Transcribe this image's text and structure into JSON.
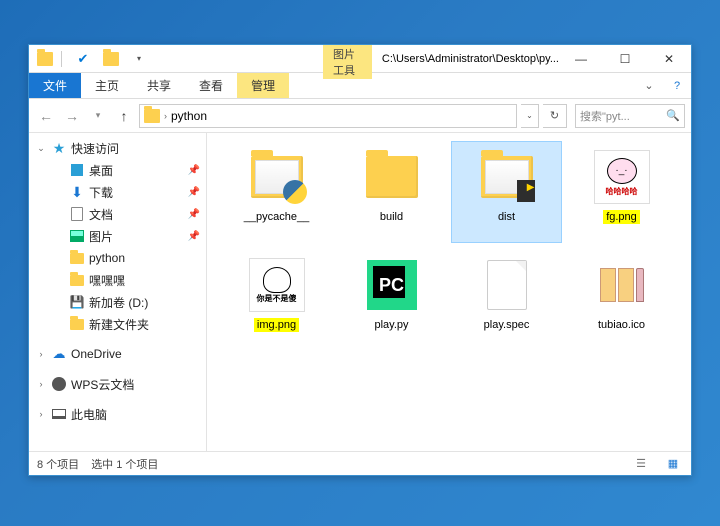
{
  "titlebar": {
    "context_label": "图片工具",
    "title": "C:\\Users\\Administrator\\Desktop\\py...",
    "min": "—",
    "max": "☐",
    "close": "✕"
  },
  "ribbon": {
    "file": "文件",
    "home": "主页",
    "share": "共享",
    "view": "查看",
    "manage": "管理"
  },
  "addr": {
    "current": "python",
    "sep": "›"
  },
  "search": {
    "placeholder": "搜索\"pyt..."
  },
  "tree": {
    "quick": "快速访问",
    "desktop": "桌面",
    "downloads": "下载",
    "documents": "文档",
    "pictures": "图片",
    "python": "python",
    "heihei": "嘿嘿嘿",
    "newvol": "新加卷 (D:)",
    "newfolder": "新建文件夹",
    "onedrive": "OneDrive",
    "wps": "WPS云文档",
    "thispc": "此电脑"
  },
  "files": {
    "pycache": "__pycache__",
    "build": "build",
    "dist": "dist",
    "fg": "fg.png",
    "fg_caption": "哈哈哈哈",
    "img": "img.png",
    "img_caption": "你是不是傻",
    "play": "play.py",
    "pc_letters": "PC",
    "spec": "play.spec",
    "tubiao": "tubiao.ico"
  },
  "status": {
    "count": "8 个项目",
    "selected": "选中 1 个项目"
  }
}
